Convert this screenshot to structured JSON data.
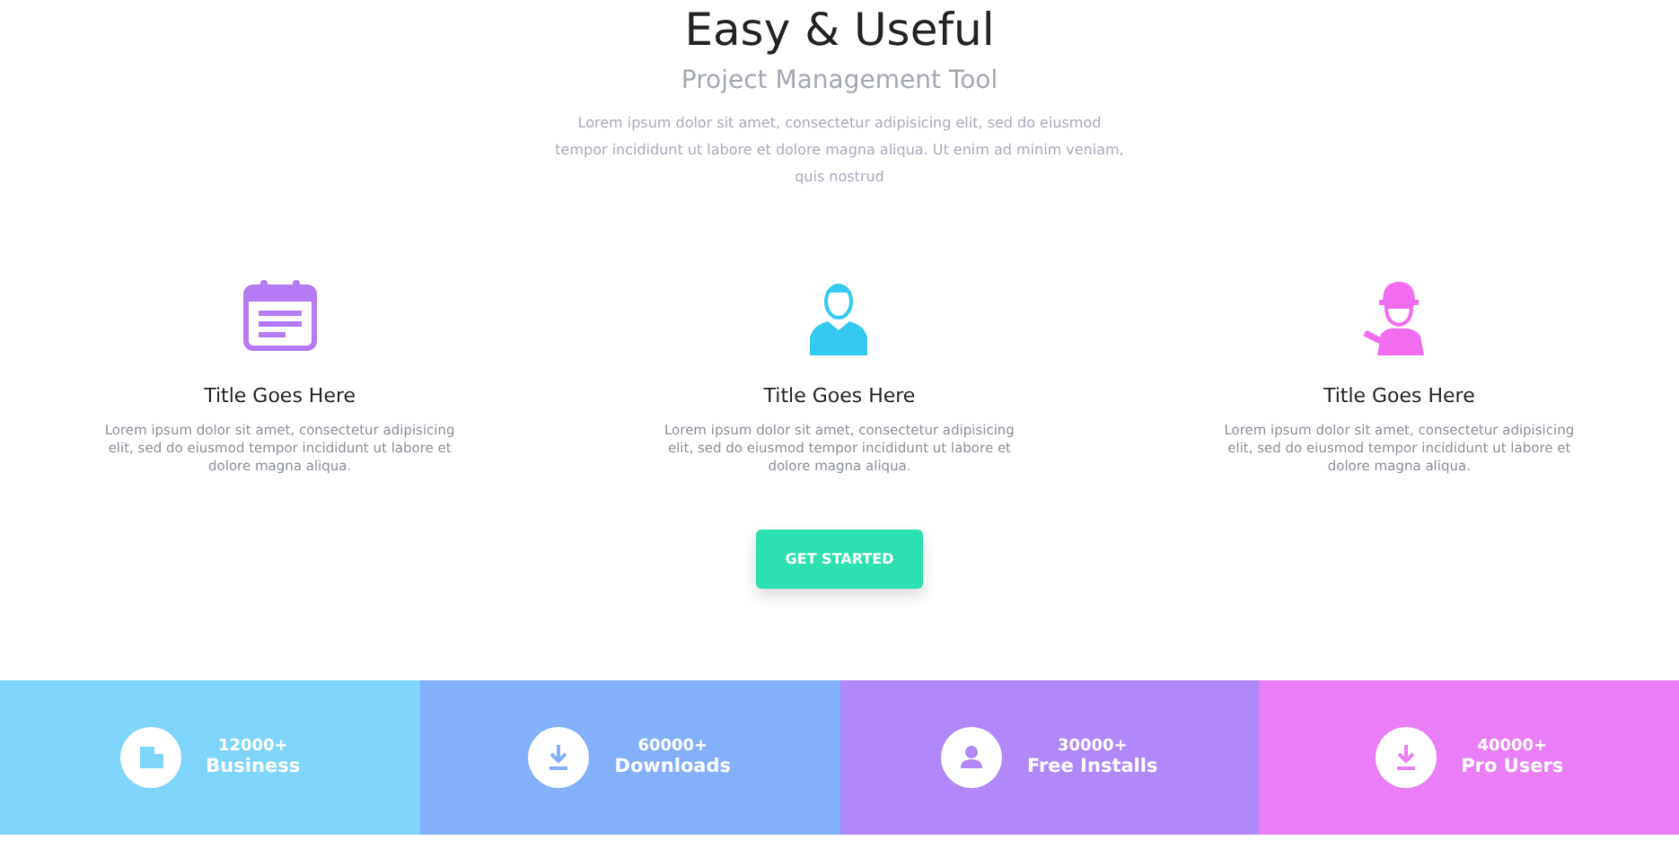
{
  "header": {
    "title": "Easy & Useful",
    "subtitle": "Project Management Tool",
    "intro": "Lorem ipsum dolor sit amet, consectetur adipisicing elit, sed do eiusmod tempor incididunt ut labore et dolore magna aliqua. Ut enim ad minim veniam, quis nostrud"
  },
  "features": [
    {
      "kind": "calendar",
      "color": "#b57bf5",
      "title": "Title Goes Here",
      "text": "Lorem ipsum dolor sit amet, consectetur adipisicing elit, sed do eiusmod tempor incididunt ut labore et dolore magna aliqua."
    },
    {
      "kind": "person",
      "color": "#33c9f0",
      "title": "Title Goes Here",
      "text": "Lorem ipsum dolor sit amet, consectetur adipisicing elit, sed do eiusmod tempor incididunt ut labore et dolore magna aliqua."
    },
    {
      "kind": "worker",
      "color": "#f26cf0",
      "title": "Title Goes Here",
      "text": "Lorem ipsum dolor sit amet, consectetur adipisicing elit, sed do eiusmod tempor incididunt ut labore et dolore magna aliqua."
    }
  ],
  "cta": {
    "label": "GET STARTED"
  },
  "stats": [
    {
      "kind": "building",
      "color": "#7fd5fb",
      "count": "12000+",
      "label": "Business"
    },
    {
      "kind": "download",
      "color": "#82b0fb",
      "count": "60000+",
      "label": "Downloads"
    },
    {
      "kind": "user",
      "color": "#b088f9",
      "count": "30000+",
      "label": "Free Installs"
    },
    {
      "kind": "download",
      "color": "#ea7ef7",
      "count": "40000+",
      "label": "Pro Users"
    }
  ]
}
